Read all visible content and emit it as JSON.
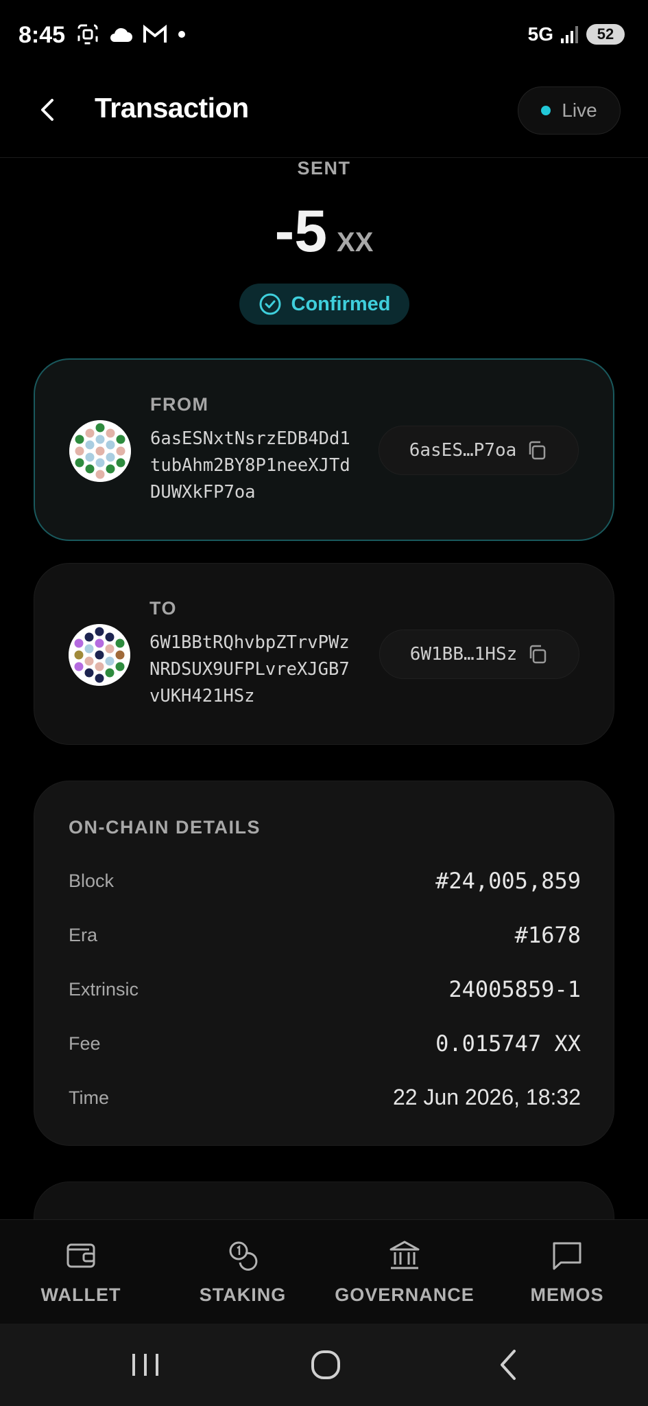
{
  "status_bar": {
    "time": "8:45",
    "network": "5G",
    "battery": "52"
  },
  "header": {
    "title": "Transaction",
    "live_label": "Live"
  },
  "summary": {
    "direction": "SENT",
    "amount": "-5",
    "unit": "XX",
    "status": "Confirmed"
  },
  "from": {
    "label": "FROM",
    "address": "6asESNxtNsrzEDB4Dd1tubAhm2BY8P1neeXJTdDUWXkFP7oa",
    "short": "6asES…P7oa"
  },
  "to": {
    "label": "TO",
    "address": "6W1BBtRQhvbpZTrvPWzNRDSUX9UFPLvreXJGB7vUKH421HSz",
    "short": "6W1BB…1HSz"
  },
  "details": {
    "title": "ON-CHAIN DETAILS",
    "rows": [
      {
        "key": "Block",
        "value": "#24,005,859"
      },
      {
        "key": "Era",
        "value": "#1678"
      },
      {
        "key": "Extrinsic",
        "value": "24005859-1"
      },
      {
        "key": "Fee",
        "value": "0.015747 XX"
      },
      {
        "key": "Time",
        "value": "22 Jun 2026, 18:32"
      }
    ]
  },
  "nav": [
    {
      "label": "WALLET",
      "icon": "wallet-icon"
    },
    {
      "label": "STAKING",
      "icon": "coins-icon"
    },
    {
      "label": "GOVERNANCE",
      "icon": "bank-icon"
    },
    {
      "label": "MEMOS",
      "icon": "chat-icon"
    }
  ],
  "colors": {
    "accent": "#3fcfdc",
    "live_dot": "#22c8d8",
    "background": "#000000",
    "card": "#111111"
  }
}
